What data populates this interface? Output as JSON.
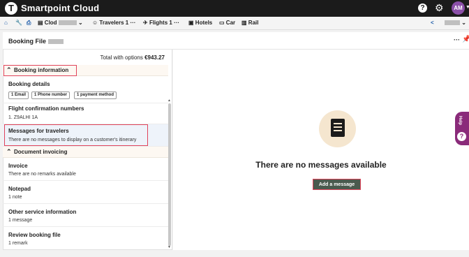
{
  "app": {
    "title": "Smartpoint Cloud",
    "logo_letter": "T",
    "user_initials": "AM"
  },
  "nav": {
    "pnr_prefix": "Clod",
    "travelers_label": "Travelers",
    "travelers_count": "1",
    "flights_label": "Flights",
    "flights_count": "1",
    "more": "···",
    "hotels": "Hotels",
    "car": "Car",
    "rail": "Rail"
  },
  "booking": {
    "title": "Booking File",
    "total_label": "Total with options",
    "total_value": "€943.27",
    "more": "···"
  },
  "sections": {
    "booking_information": "Booking information",
    "document_invoicing": "Document invoicing"
  },
  "items": {
    "booking_details": {
      "title": "Booking details",
      "chips": [
        "1 Email",
        "1 Phone number",
        "1 payment method"
      ]
    },
    "flight_conf": {
      "title": "Flight confirmation numbers",
      "value": "1. Z9ALHI 1A"
    },
    "messages": {
      "title": "Messages for travelers",
      "subtitle": "There are no messages to display on a customer's itinerary"
    },
    "invoice": {
      "title": "Invoice",
      "subtitle": "There are no remarks available"
    },
    "notepad": {
      "title": "Notepad",
      "subtitle": "1 note"
    },
    "other_service": {
      "title": "Other service information",
      "subtitle": "1 message"
    },
    "review": {
      "title": "Review booking file",
      "subtitle": "1 remark"
    }
  },
  "empty_state": {
    "text": "There are no messages available",
    "button": "Add a message"
  },
  "help_tab": {
    "label": "Help",
    "q": "?"
  },
  "icons": {
    "home": "home-icon",
    "wrench": "wrench-icon",
    "printer": "printer-icon",
    "file": "file-icon",
    "user": "user-icon",
    "plane": "plane-icon",
    "hotel": "hotel-icon",
    "car": "car-icon",
    "rail": "rail-icon",
    "share": "share-icon",
    "help": "help-icon",
    "gear": "gear-icon",
    "pin": "pin-icon"
  },
  "colors": {
    "topbar": "#1b1b1b",
    "accent": "#1a5aa8",
    "highlight": "#e0435a",
    "avatar": "#8a4fa8",
    "add_button": "#4a5a4e",
    "help_tab": "#8a2b7a"
  }
}
